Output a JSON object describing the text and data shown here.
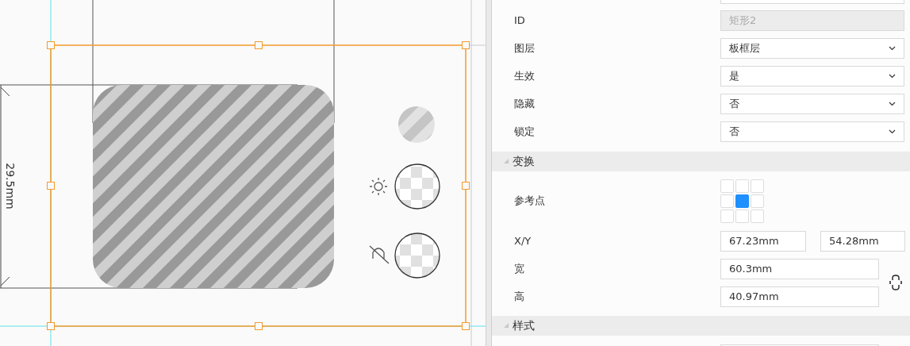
{
  "canvas": {
    "dimension_label": "29.5mm"
  },
  "properties": [
    {
      "kind": "text",
      "label": "ID",
      "value": "矩形2",
      "disabled": true
    },
    {
      "kind": "select",
      "label": "图层",
      "value": "板框层",
      "disabled": false
    },
    {
      "kind": "select",
      "label": "生效",
      "value": "是",
      "disabled": false
    },
    {
      "kind": "select",
      "label": "隐藏",
      "value": "否",
      "disabled": false
    },
    {
      "kind": "select",
      "label": "锁定",
      "value": "否",
      "disabled": false
    }
  ],
  "transform_section": {
    "title": "变换",
    "expanded": true
  },
  "reference_point": {
    "label": "参考点",
    "cells": [
      {
        "selected": false
      },
      {
        "selected": false
      },
      {
        "selected": false
      },
      {
        "selected": false
      },
      {
        "selected": true
      },
      {
        "selected": false
      },
      {
        "selected": false
      },
      {
        "selected": false
      },
      {
        "selected": false
      }
    ]
  },
  "position": {
    "label": "X/Y",
    "x": "67.23mm",
    "y": "54.28mm"
  },
  "width": {
    "label": "宽",
    "value": "60.3mm"
  },
  "height": {
    "label": "高",
    "value": "40.97mm"
  },
  "style_section": {
    "title": "样式",
    "expanded": true
  }
}
